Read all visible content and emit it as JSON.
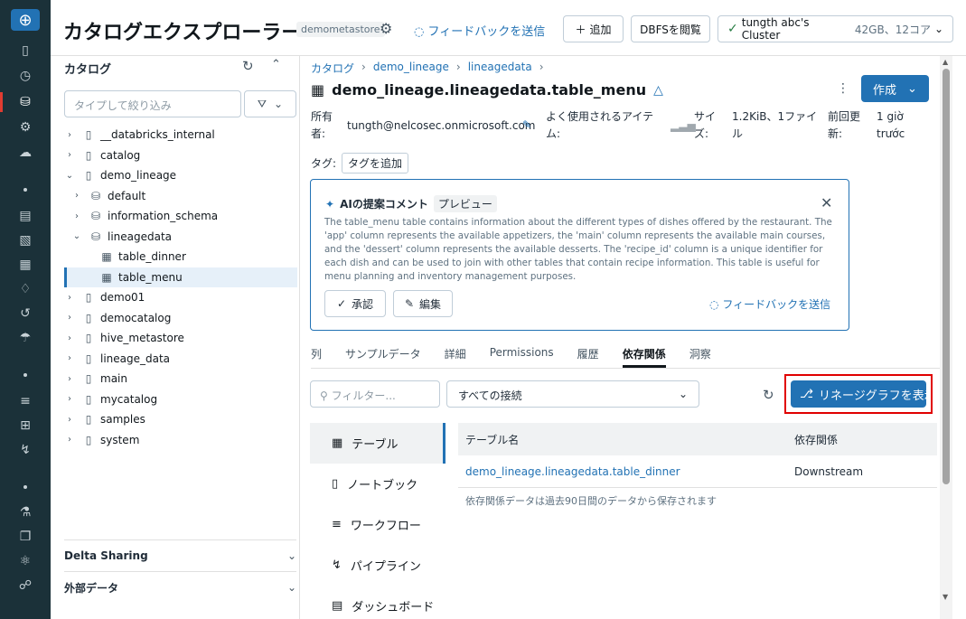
{
  "header": {
    "title": "カタログエクスプローラー",
    "metastore": "demometastore",
    "feedback": "フィードバックを送信",
    "add_label": "追加",
    "dbfs_label": "DBFSを閲覧",
    "cluster_name": "tungth abc's Cluster",
    "cluster_meta": "42GB、12コア"
  },
  "catalog_panel": {
    "title": "カタログ",
    "search_placeholder": "タイプして絞り込み",
    "tree": [
      {
        "label": "__databricks_internal",
        "expanded": false
      },
      {
        "label": "catalog",
        "expanded": false
      },
      {
        "label": "demo_lineage",
        "expanded": true
      },
      {
        "label": "default",
        "expanded": false
      },
      {
        "label": "information_schema",
        "expanded": false
      },
      {
        "label": "lineagedata",
        "expanded": true
      },
      {
        "label": "table_dinner"
      },
      {
        "label": "table_menu",
        "selected": true
      },
      {
        "label": "demo01",
        "expanded": false
      },
      {
        "label": "democatalog",
        "expanded": false
      },
      {
        "label": "hive_metastore",
        "expanded": false
      },
      {
        "label": "lineage_data",
        "expanded": false
      },
      {
        "label": "main",
        "expanded": false
      },
      {
        "label": "mycatalog",
        "expanded": false
      },
      {
        "label": "samples",
        "expanded": false
      },
      {
        "label": "system",
        "expanded": false
      }
    ],
    "sections": [
      "Delta Sharing",
      "外部データ"
    ]
  },
  "main": {
    "breadcrumb": [
      "カタログ",
      "demo_lineage",
      "lineagedata"
    ],
    "table_name": "demo_lineage.lineagedata.table_menu",
    "create_label": "作成",
    "owner_label": "所有者:",
    "owner_value": "tungth@nelcosec.onmicrosoft.com",
    "popularity_label": "よく使用されるアイテム:",
    "size_label": "サイズ:",
    "size_value": "1.2KiB、1ファイル",
    "updated_label": "前回更新:",
    "updated_value": "1 giờ trước",
    "tags_label": "タグ:",
    "add_tag_label": "タグを追加",
    "ai": {
      "title": "AIの提案コメント",
      "badge": "プレビュー",
      "text": "The table_menu table contains information about the different types of dishes offered by the restaurant. The 'app' column represents the available appetizers, the 'main' column represents the available main courses, and the 'dessert' column represents the available desserts. The 'recipe_id' column is a unique identifier for each dish and can be used to join with other tables that contain recipe information. This table is useful for menu planning and inventory management purposes.",
      "approve_label": "承認",
      "edit_label": "編集",
      "feedback_label": "フィードバックを送信"
    },
    "tabs": [
      "列",
      "サンプルデータ",
      "詳細",
      "Permissions",
      "履歴",
      "依存関係",
      "洞察"
    ],
    "active_tab": "依存関係",
    "filter_placeholder": "フィルター...",
    "connection_select": "すべての接続",
    "lineage_button": "リネージグラフを表示",
    "dep_types": [
      "テーブル",
      "ノートブック",
      "ワークフロー",
      "パイプライン",
      "ダッシュボード"
    ],
    "dep_table": {
      "columns": [
        "テーブル名",
        "依存関係"
      ],
      "rows": [
        {
          "name": "demo_lineage.lineagedata.table_dinner",
          "dependency": "Downstream"
        }
      ],
      "note": "依存関係データは過去90日間のデータから保存されます"
    }
  }
}
